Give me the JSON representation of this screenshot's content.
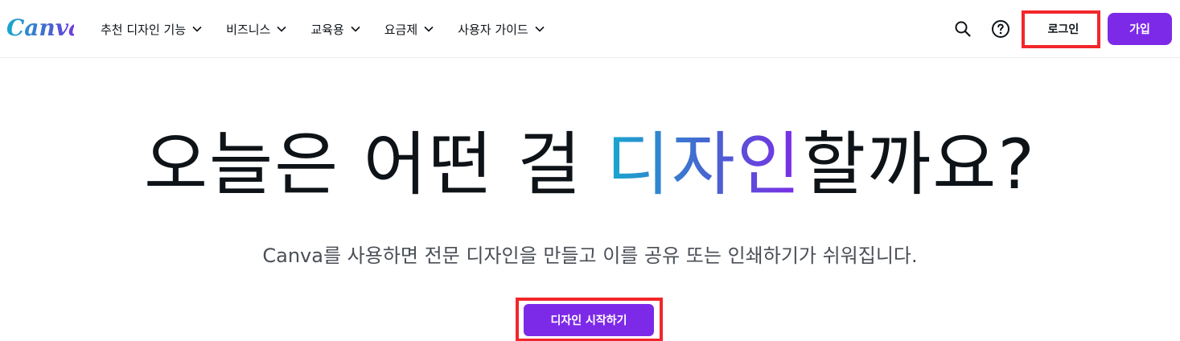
{
  "header": {
    "logo_text": "Canva",
    "nav": [
      {
        "label": "추천 디자인 기능"
      },
      {
        "label": "비즈니스"
      },
      {
        "label": "교육용"
      },
      {
        "label": "요금제"
      },
      {
        "label": "사용자 가이드"
      }
    ],
    "search_icon": "search-icon",
    "help_icon": "help-icon",
    "login_label": "로그인",
    "signup_label": "가입"
  },
  "hero": {
    "title_before": "오늘은 어떤 걸 ",
    "title_highlight": "디자인",
    "title_after": "할까요?",
    "subtitle": "Canva를 사용하면 전문 디자인을 만들고 이를 공유 또는 인쇄하기가 쉬워집니다.",
    "cta_label": "디자인 시작하기"
  },
  "colors": {
    "brand_purple": "#7d2ae8",
    "gradient_start": "#17a9ce",
    "gradient_end": "#7d2ae8",
    "highlight_box": "#f2262b"
  }
}
